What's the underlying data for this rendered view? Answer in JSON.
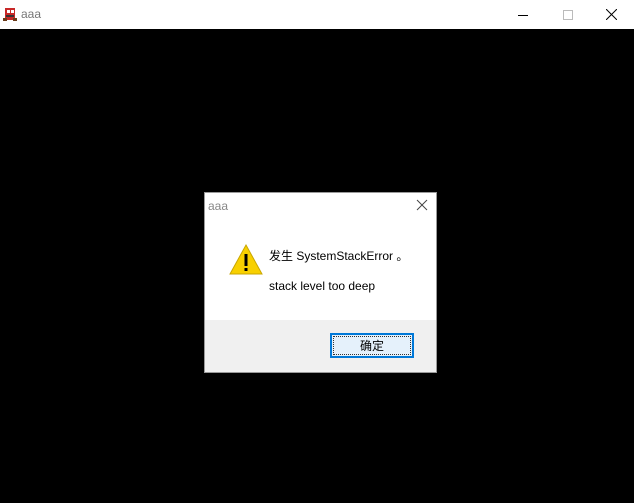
{
  "window": {
    "title": "aaa",
    "icon": "app-icon",
    "controls": [
      "minimize-icon",
      "maximize-icon",
      "close-icon"
    ]
  },
  "dialog": {
    "title": "aaa",
    "icon": "warning-icon",
    "message_line1": "发生 SystemStackError 。",
    "message_line2": "stack level too deep",
    "ok_label": "确定"
  }
}
